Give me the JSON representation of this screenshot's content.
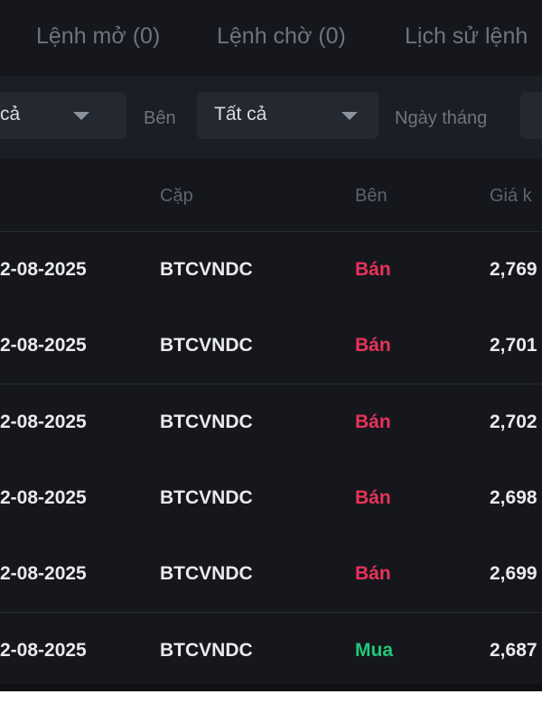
{
  "tabs": [
    {
      "label": "Lệnh mở (0)"
    },
    {
      "label": "Lệnh chờ (0)"
    },
    {
      "label": "Lịch sử lệnh"
    }
  ],
  "filters": {
    "first_value": "cả",
    "side_label": "Bên",
    "side_value": "Tất cả",
    "date_label": "Ngày tháng"
  },
  "table": {
    "headers": {
      "pair": "Cặp",
      "side": "Bên",
      "price": "Giá k"
    },
    "rows": [
      {
        "date": "2-08-2025",
        "pair": "BTCVNDC",
        "side": "Bán",
        "price": "2,769"
      },
      {
        "date": "2-08-2025",
        "pair": "BTCVNDC",
        "side": "Bán",
        "price": "2,701"
      },
      {
        "date": "2-08-2025",
        "pair": "BTCVNDC",
        "side": "Bán",
        "price": "2,702"
      },
      {
        "date": "2-08-2025",
        "pair": "BTCVNDC",
        "side": "Bán",
        "price": "2,698"
      },
      {
        "date": "2-08-2025",
        "pair": "BTCVNDC",
        "side": "Bán",
        "price": "2,699"
      },
      {
        "date": "2-08-2025",
        "pair": "BTCVNDC",
        "side": "Mua",
        "price": "2,687"
      }
    ]
  },
  "colors": {
    "sell": "#e8325a",
    "buy": "#20c97a"
  }
}
